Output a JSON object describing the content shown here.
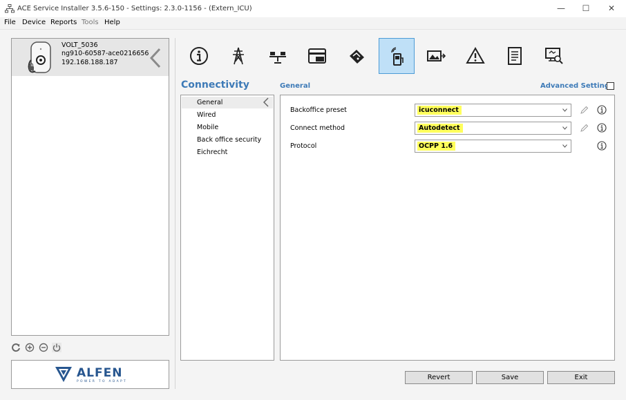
{
  "window": {
    "title": "ACE Service Installer 3.5.6-150 - Settings: 2.3.0-1156 -  (Extern_ICU)",
    "app_icon": "network-icon",
    "controls": [
      "minimize-icon",
      "maximize-icon",
      "close-icon"
    ]
  },
  "menu": [
    {
      "label": "File",
      "enabled": true
    },
    {
      "label": "Device",
      "enabled": true
    },
    {
      "label": "Reports",
      "enabled": true
    },
    {
      "label": "Tools",
      "enabled": false
    },
    {
      "label": "Help",
      "enabled": true
    }
  ],
  "device": {
    "name": "VOLT_5036",
    "serial": "ng910-60587-ace0216656",
    "ip": "192.168.188.187",
    "icon": "charger-icon"
  },
  "device_tools": [
    "refresh-icon",
    "add-icon",
    "remove-icon",
    "power-icon"
  ],
  "logo": {
    "text": "ALFEN",
    "tagline": "POWER TO ADAPT"
  },
  "toolbar": {
    "buttons": [
      "info-icon",
      "power-line-icon",
      "load-balancing-icon",
      "card-reader-icon",
      "tariff-icon",
      "connectivity-icon",
      "display-icon",
      "warning-icon",
      "report-icon",
      "diagnostics-icon"
    ],
    "active": "connectivity-icon"
  },
  "section": {
    "title": "Connectivity",
    "nav": [
      "General",
      "Wired",
      "Mobile",
      "Back office security",
      "Eichrecht"
    ],
    "selected": "General"
  },
  "general": {
    "title": "General",
    "advanced_label": "Advanced Settings",
    "advanced_checked": false,
    "fields": [
      {
        "label": "Backoffice preset",
        "value": "icuconnect",
        "editable": true
      },
      {
        "label": "Connect method",
        "value": "Autodetect",
        "editable": true
      },
      {
        "label": "Protocol",
        "value": "OCPP 1.6",
        "editable": false
      }
    ],
    "highlight_color": "#ffff5c"
  },
  "actions": {
    "revert": "Revert",
    "save": "Save",
    "exit": "Exit"
  },
  "colors": {
    "accent": "#3d7ab7",
    "active_tab": "#bfe0f7",
    "logo": "#27568f"
  }
}
